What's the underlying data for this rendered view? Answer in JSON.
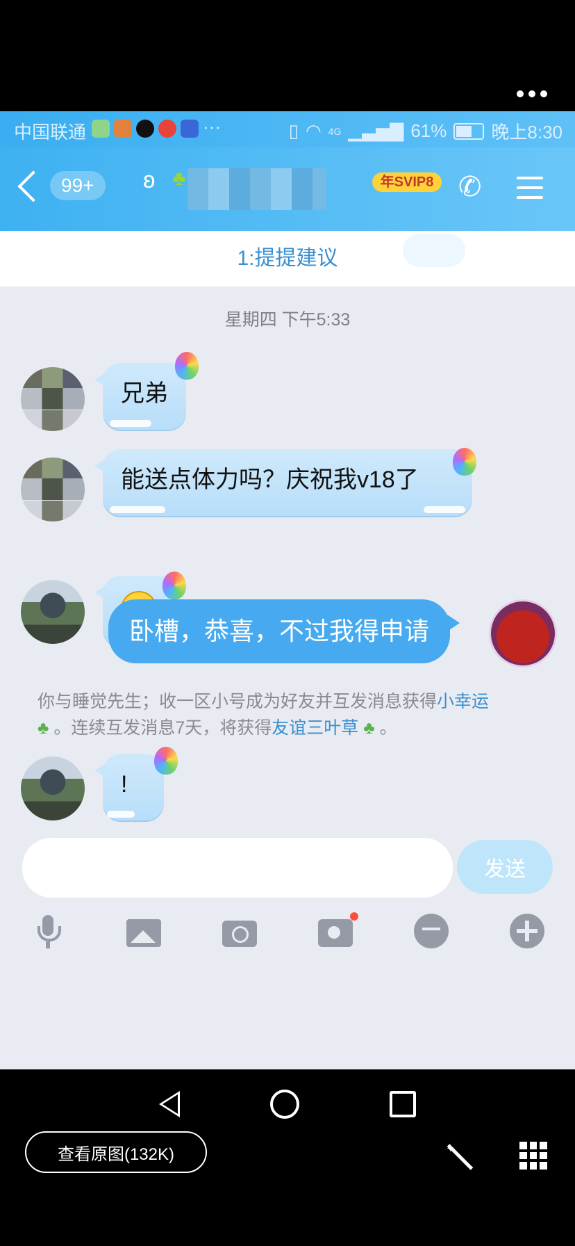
{
  "status_bar": {
    "carrier": "中国联通",
    "more": "···",
    "network": "4G",
    "battery": "61%",
    "time": "晚上8:30"
  },
  "header": {
    "unread": "99+",
    "vip_badge": "年SVIP8"
  },
  "banner": {
    "text": "1:提提建议"
  },
  "chat": {
    "timestamp": "星期四 下午5:33",
    "messages": [
      {
        "text": "兄弟"
      },
      {
        "text": "能送点体力吗？庆祝我v18了"
      },
      {
        "text": ""
      },
      {
        "text": "卧槽，恭喜，不过我得申请"
      },
      {
        "text": "!"
      }
    ],
    "system": {
      "part1": "你与睡觉先生；收一区小号成为好友并互发消息获得",
      "link1": "小幸运",
      "part2": "。连续互发消息7天，将获得",
      "link2": "友谊三叶草",
      "part3": "。"
    }
  },
  "input": {
    "placeholder": "",
    "send_label": "发送"
  },
  "viewer": {
    "original_button": "查看原图(132K)"
  },
  "colors": {
    "header": "#3eb1f1",
    "my_bubble": "#47a9ef",
    "link": "#3a8fd0"
  }
}
